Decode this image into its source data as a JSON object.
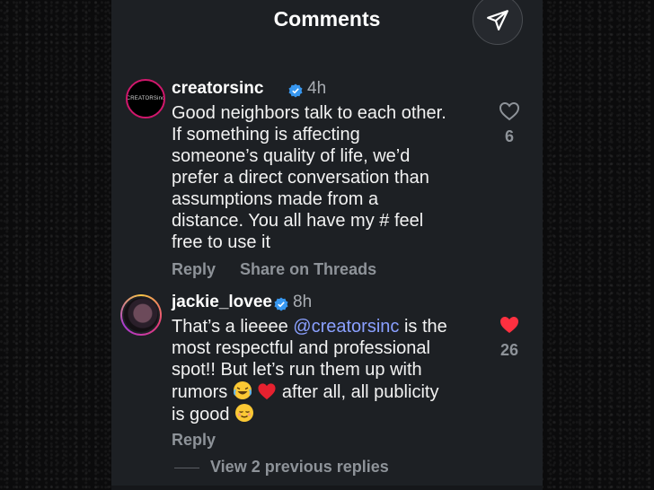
{
  "header": {
    "title": "Comments"
  },
  "comments": [
    {
      "username": "creatorsinc",
      "avatar_text": "CREATORSinc",
      "time": "4h",
      "lines": [
        "Good neighbors talk to each other.",
        "If something is affecting",
        "someone’s quality of life, we’d",
        "prefer a direct conversation than",
        "assumptions made from a",
        "distance. You all have my # feel",
        "free to use it"
      ],
      "reply_label": "Reply",
      "share_label": "Share on Threads",
      "like_count": "6"
    },
    {
      "username": "jackie_lovee",
      "time": "8h",
      "line1_pre": "That’s a lieeee ",
      "line1_mention": "@creatorsinc",
      "line1_post": " is the",
      "line2": "most respectful and professional",
      "line3": "spot!! But let’s run them up with",
      "line4_pre": "rumors ",
      "line4_post": "  after all, all publicity",
      "line5_pre": "is good ",
      "reply_label": "Reply",
      "like_count": "26"
    }
  ],
  "view_replies": "View 2 previous replies",
  "colors": {
    "accent_like": "#ff3040",
    "verified": "#3797f0",
    "mention": "#8aa0ff"
  },
  "icons": [
    "send-icon",
    "verified-icon",
    "heart-outline-icon",
    "heart-filled-icon",
    "laughing-emoji-icon",
    "red-heart-emoji-icon",
    "relieved-emoji-icon"
  ]
}
